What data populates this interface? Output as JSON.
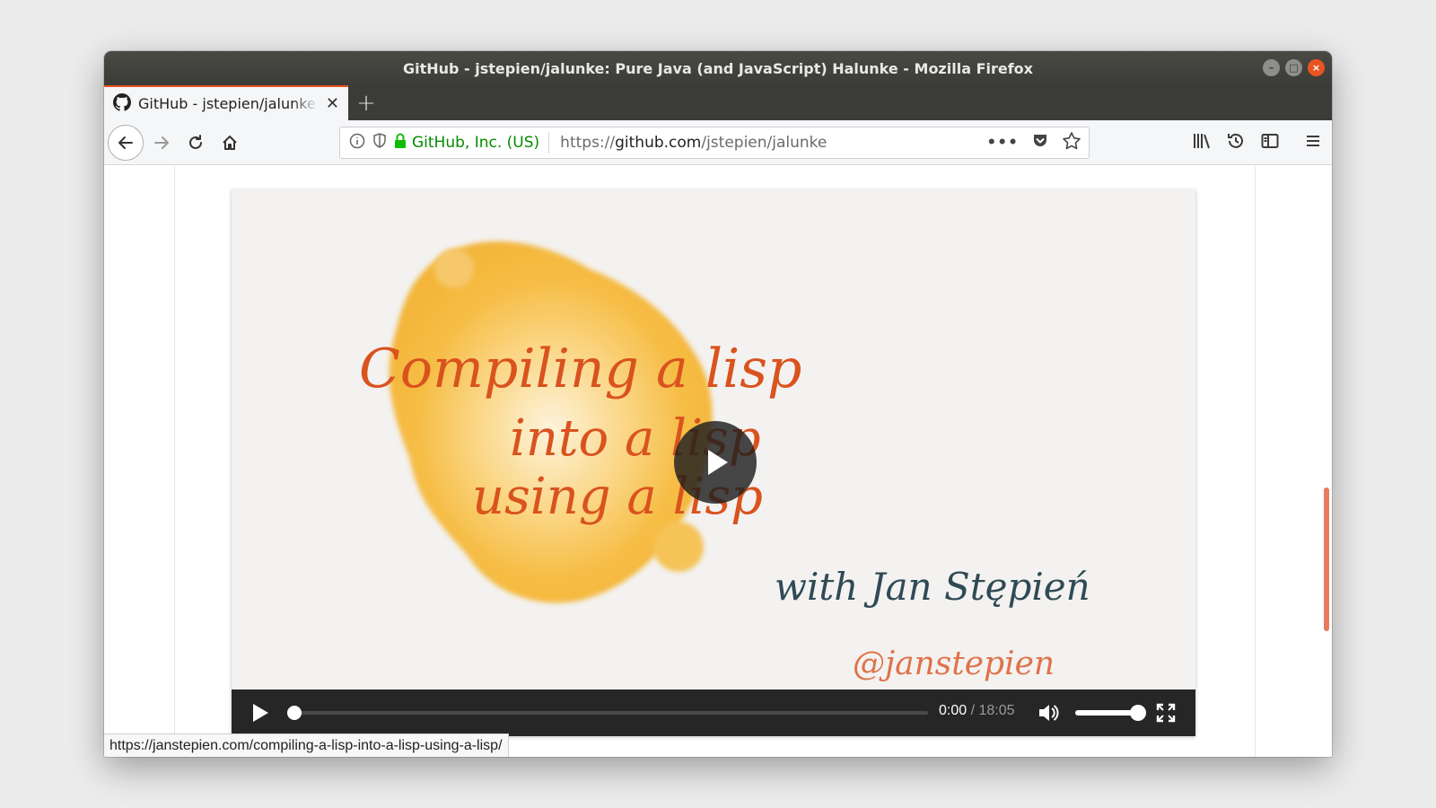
{
  "window": {
    "title": "GitHub - jstepien/jalunke: Pure Java (and JavaScript) Halunke - Mozilla Firefox",
    "controls": {
      "minimize": "–",
      "maximize": "□",
      "close": "×"
    }
  },
  "tabs": [
    {
      "label": "GitHub - jstepien/jalunke",
      "icon": "github-icon",
      "active": true
    }
  ],
  "navbar": {
    "identity_label": "GitHub, Inc. (US)",
    "url_prefix": "https://",
    "url_domain": "github.com",
    "url_path": "/jstepien/jalunke",
    "page_actions_label": "•••"
  },
  "video": {
    "title_line1": "Compiling a lisp",
    "title_line2": "into a lisp",
    "title_line3": "using a lisp",
    "byline": "with Jan Stępień",
    "handle": "@janstepien",
    "current_time": "0:00",
    "duration": "/ 18:05",
    "progress": 0,
    "volume": 1.0
  },
  "status_bar": {
    "url": "https://janstepien.com/compiling-a-lisp-into-a-lisp-using-a-lisp/"
  },
  "colors": {
    "accent": "#e95420",
    "identity_green": "#058b00",
    "title_orange": "#d9531e",
    "title_teal": "#2f4a55"
  }
}
